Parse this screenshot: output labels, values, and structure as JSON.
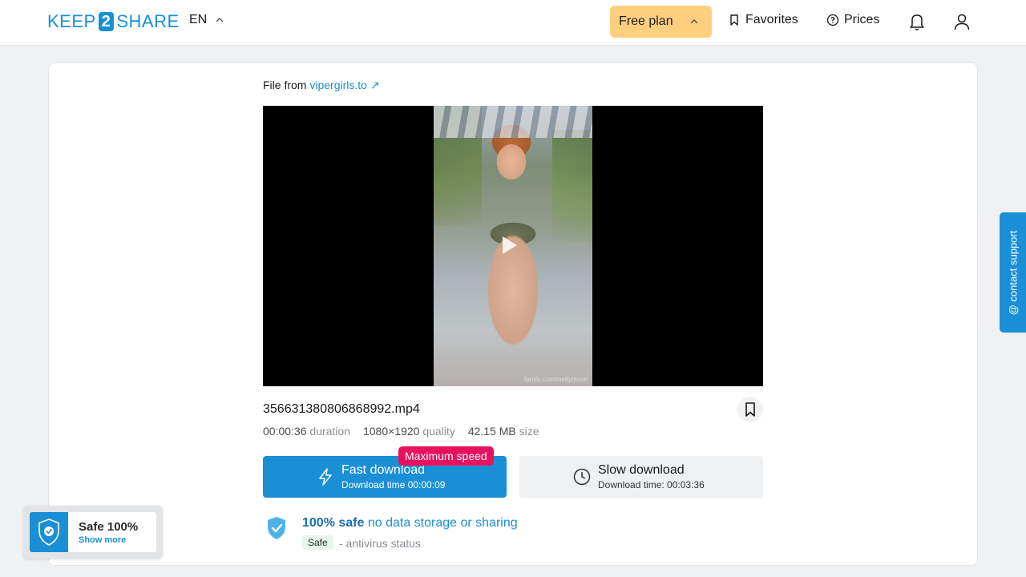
{
  "header": {
    "logo_left": "KEEP",
    "logo_mid": "2",
    "logo_right": "SHARE",
    "language": "EN",
    "plan_label": "Free plan",
    "favorites_label": "Favorites",
    "prices_label": "Prices"
  },
  "file": {
    "from_prefix": "File from",
    "source_site": "vipergirls.to",
    "name": "356631380806868992.mp4",
    "duration": "00:00:36",
    "duration_label": "duration",
    "quality": "1080×1920",
    "quality_label": "quality",
    "size": "42.15 MB",
    "size_label": "size",
    "watermark": "fansly.com/meltymoon"
  },
  "download": {
    "fast_title": "Fast download",
    "fast_sub": "Download time 00:00:09",
    "max_speed_badge": "Maximum speed",
    "slow_title": "Slow download",
    "slow_sub": "Download time: 00:03:36"
  },
  "safety": {
    "title_bold": "100% safe",
    "title_rest": "no data storage or sharing",
    "badge": "Safe",
    "status_text": "- antivirus status"
  },
  "contact_support": "@ contact support",
  "float_widget": {
    "title": "Safe 100%",
    "link": "Show more"
  },
  "colors": {
    "brand_blue": "#1a8fd6",
    "plan_yellow": "#ffcf80",
    "badge_pink": "#e8125c"
  }
}
